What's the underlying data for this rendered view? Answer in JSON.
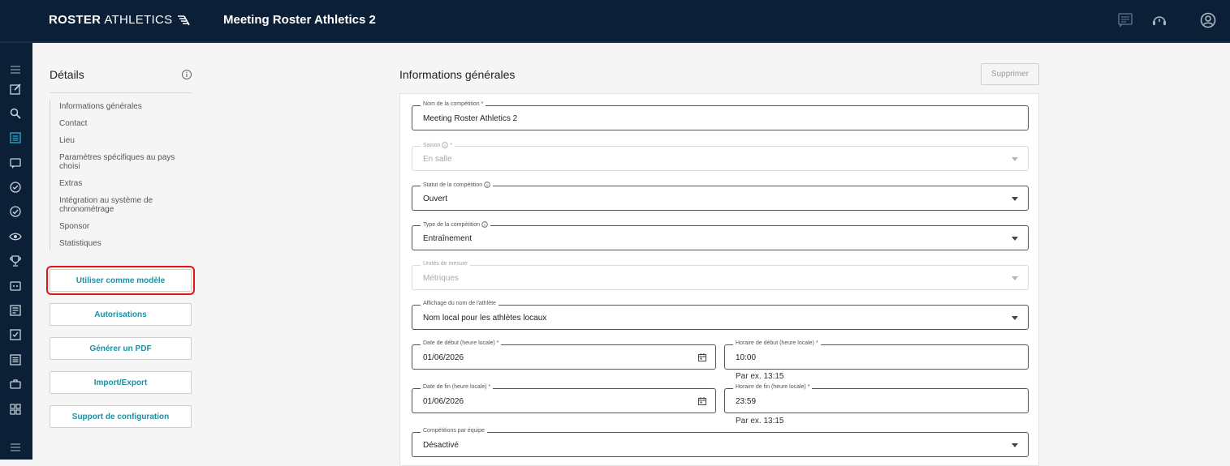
{
  "header": {
    "brand_bold": "ROSTER",
    "brand_light": "ATHLETICS",
    "title": "Meeting Roster Athletics 2",
    "icons": [
      "chat-icon",
      "headset-support-icon",
      "account-circle-icon"
    ]
  },
  "rail": {
    "icons": [
      "menu-icon",
      "edit-icon",
      "search-icon",
      "document-list-icon",
      "message-icon",
      "check-circle-icon",
      "check-circle-outline-icon",
      "eye-icon",
      "trophy-icon",
      "scoreboard-icon",
      "newspaper-icon",
      "checkbox-icon",
      "list-icon",
      "briefcase-icon",
      "apps-grid-icon",
      "menu-bottom-icon"
    ]
  },
  "sidebar": {
    "title": "Détails",
    "toc": [
      "Informations générales",
      "Contact",
      "Lieu",
      "Paramètres spécifiques au pays choisi",
      "Extras",
      "Intégration au système de chronométrage",
      "Sponsor",
      "Statistiques"
    ],
    "buttons": {
      "template": "Utiliser comme modèle",
      "permissions": "Autorisations",
      "pdf": "Générer un PDF",
      "import_export": "Import/Export",
      "support": "Support de configuration"
    }
  },
  "main": {
    "title": "Informations générales",
    "delete_label": "Supprimer",
    "fields": {
      "name": {
        "label": "Nom de la compétition *",
        "value": "Meeting Roster Athletics 2"
      },
      "season": {
        "label": "Saison",
        "label_suffix": " *",
        "value": "En salle"
      },
      "status": {
        "label": "Statut de la compétition",
        "value": "Ouvert"
      },
      "type": {
        "label": "Type de la compétition",
        "value": "Entraînement"
      },
      "units": {
        "label": "Unités de mesure",
        "value": "Métriques"
      },
      "name_display": {
        "label": "Affichage du nom de l'athlète",
        "value": "Nom local pour les athlètes locaux"
      },
      "start_date": {
        "label": "Date de début (heure locale) *",
        "value": "01/06/2026"
      },
      "start_time": {
        "label": "Horaire de début (heure locale) *",
        "value": "10:00",
        "helper": "Par ex. 13:15"
      },
      "end_date": {
        "label": "Date de fin (heure locale) *",
        "value": "01/06/2026"
      },
      "end_time": {
        "label": "Horaire de fin (heure locale) *",
        "value": "23:59",
        "helper": "Par ex. 13:15"
      },
      "team": {
        "label": "Compétitions par équipe",
        "value": "Désactivé"
      }
    }
  },
  "colors": {
    "topbar": "#0b2036",
    "accent": "#1f8fa0",
    "highlight": "#e01616"
  }
}
